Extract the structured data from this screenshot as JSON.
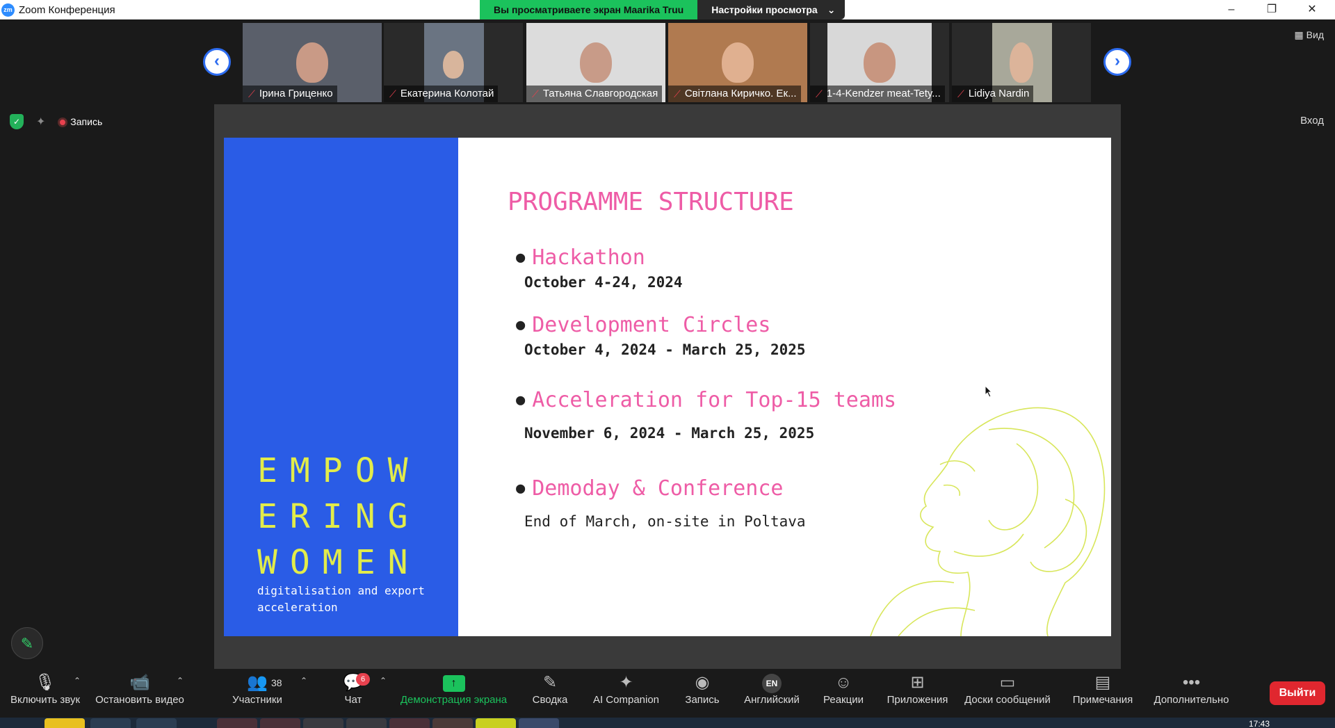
{
  "window": {
    "app_icon": "zm",
    "title": "Zoom Конференция",
    "minimize_icon": "–",
    "restore_icon": "❐",
    "close_icon": "✕"
  },
  "share_banner": {
    "viewing_text": "Вы просматриваете экран Maarika Truu",
    "view_options": "Настройки просмотра",
    "chevron": "⌄"
  },
  "gallery": {
    "prev_icon": "‹",
    "next_icon": "›",
    "participants": [
      {
        "name": "Ірина Гриценко"
      },
      {
        "name": "Екатерина Колотай"
      },
      {
        "name": "Татьяна Славгородская"
      },
      {
        "name": "Світлана Киричко. Ек..."
      },
      {
        "name": "1-4-Kendzer meat-Tety..."
      },
      {
        "name": "Lidiya Nardin"
      }
    ]
  },
  "top_controls": {
    "view_label": "Вид",
    "view_icon": "▦",
    "record_label": "Запись",
    "enter_label": "Вход",
    "shield_icon": "✓",
    "sparkle_icon": "✦"
  },
  "slide": {
    "brand_lines": [
      "EMPOW",
      "ERING",
      "WOMEN"
    ],
    "brand_subtitle": "digitalisation and export acceleration",
    "title": "PROGRAMME STRUCTURE",
    "items": [
      {
        "name": "Hackathon",
        "date": "October 4-24, 2024"
      },
      {
        "name": "Development Circles",
        "date": "October 4, 2024 - March 25, 2025"
      },
      {
        "name": "Acceleration for Top-15 teams",
        "date": "November 6, 2024 - March 25, 2025"
      },
      {
        "name": "Demoday & Conference",
        "date": "End of March, on-site in Poltava"
      }
    ],
    "colors": {
      "blue_panel": "#2a5ce6",
      "accent_pink": "#ee5ca6",
      "brand_yellow": "#e2ec4a"
    }
  },
  "toolbar": {
    "pen_icon": "✎",
    "caret": "⌃",
    "mute": {
      "label": "Включить звук",
      "icon": "🎙"
    },
    "video": {
      "label": "Остановить видео",
      "icon": "📹"
    },
    "participants": {
      "label": "Участники",
      "count": "38",
      "icon": "👥"
    },
    "chat": {
      "label": "Чат",
      "badge": "6",
      "icon": "💬"
    },
    "share": {
      "label": "Демонстрация экрана",
      "icon": "↑"
    },
    "summary": {
      "label": "Сводка",
      "icon": "✎"
    },
    "ai": {
      "label": "AI Companion",
      "icon": "✦"
    },
    "record": {
      "label": "Запись",
      "icon": "◉"
    },
    "language": {
      "label": "Английский",
      "icon": "EN"
    },
    "reactions": {
      "label": "Реакции",
      "icon": "☺"
    },
    "apps": {
      "label": "Приложения",
      "icon": "⊞"
    },
    "whiteboards": {
      "label": "Доски сообщений",
      "icon": "▭"
    },
    "notes": {
      "label": "Примечания",
      "icon": "▤"
    },
    "more": {
      "label": "Дополнительно",
      "icon": "•••"
    },
    "leave": {
      "label": "Выйти"
    }
  },
  "taskbar": {
    "clock": "17:43"
  }
}
